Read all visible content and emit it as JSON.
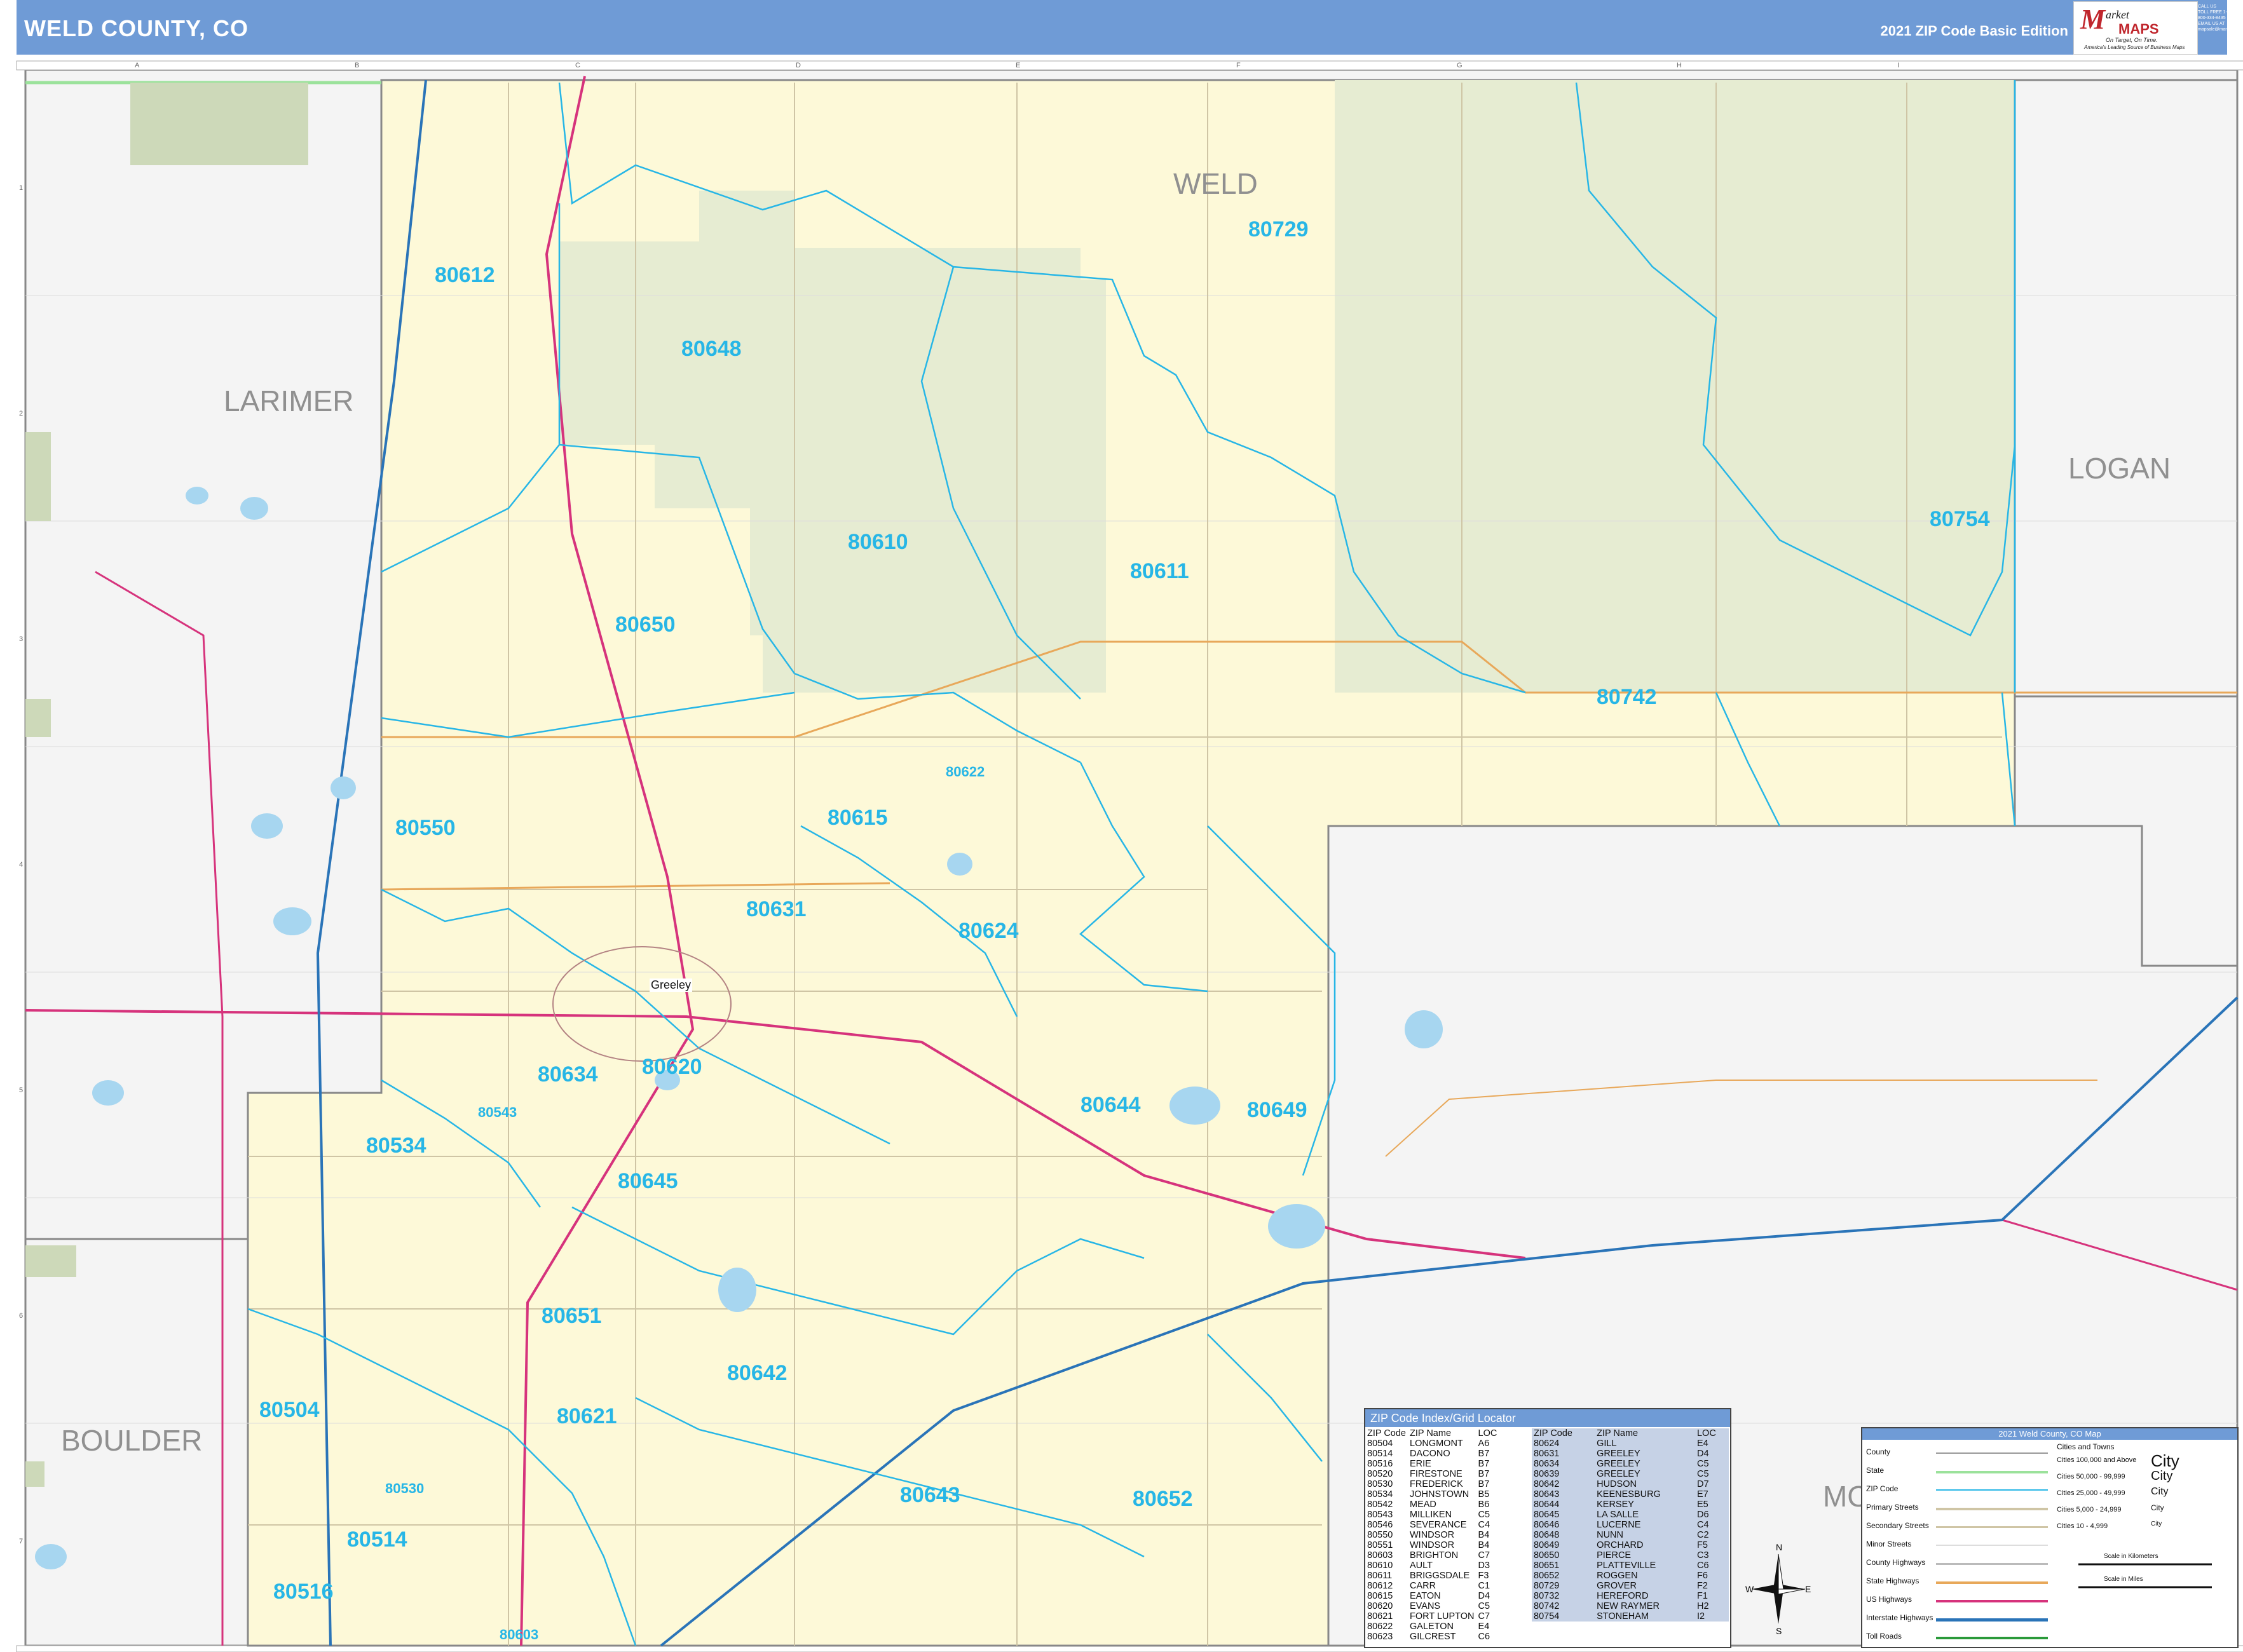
{
  "header": {
    "title": "WELD COUNTY, CO",
    "edition": "2021 ZIP Code Basic Edition",
    "logo_m": "M",
    "logo_name": "arket",
    "logo_name2": "MAPS",
    "logo_tag": "On Target, On Time.",
    "logo_tag2": "America's Leading Source of Business Maps",
    "contact": "CALL US TOLL FREE 1-800-334-8435 EMAIL US AT mapsale@marketmaps.com"
  },
  "grid": {
    "columns": [
      "A",
      "B",
      "C",
      "D",
      "E",
      "F",
      "G",
      "H",
      "I"
    ],
    "rows": [
      "1",
      "2",
      "3",
      "4",
      "5",
      "6",
      "7"
    ]
  },
  "counties": [
    {
      "name": "WELD"
    },
    {
      "name": "LARIMER"
    },
    {
      "name": "LOGAN"
    },
    {
      "name": "BOULDER"
    },
    {
      "name": "MO"
    }
  ],
  "zips": [
    {
      "code": "80729"
    },
    {
      "code": "80612"
    },
    {
      "code": "80648"
    },
    {
      "code": "80610"
    },
    {
      "code": "80611"
    },
    {
      "code": "80754"
    },
    {
      "code": "80650"
    },
    {
      "code": "80742"
    },
    {
      "code": "80622"
    },
    {
      "code": "80550"
    },
    {
      "code": "80615"
    },
    {
      "code": "80631"
    },
    {
      "code": "80624"
    },
    {
      "code": "80634"
    },
    {
      "code": "80620"
    },
    {
      "code": "80644"
    },
    {
      "code": "80649"
    },
    {
      "code": "80543"
    },
    {
      "code": "80534"
    },
    {
      "code": "80645"
    },
    {
      "code": "80651"
    },
    {
      "code": "80642"
    },
    {
      "code": "80504"
    },
    {
      "code": "80621"
    },
    {
      "code": "80643"
    },
    {
      "code": "80652"
    },
    {
      "code": "80530"
    },
    {
      "code": "80514"
    },
    {
      "code": "80516"
    },
    {
      "code": "80603"
    }
  ],
  "cities": [
    {
      "name": "Greeley"
    }
  ],
  "index": {
    "title": "ZIP Code Index/Grid Locator",
    "headers": [
      "ZIP Code",
      "ZIP Name",
      "LOC"
    ],
    "left": [
      [
        "80504",
        "LONGMONT",
        "A6"
      ],
      [
        "80514",
        "DACONO",
        "B7"
      ],
      [
        "80516",
        "ERIE",
        "B7"
      ],
      [
        "80520",
        "FIRESTONE",
        "B7"
      ],
      [
        "80530",
        "FREDERICK",
        "B7"
      ],
      [
        "80534",
        "JOHNSTOWN",
        "B5"
      ],
      [
        "80542",
        "MEAD",
        "B6"
      ],
      [
        "80543",
        "MILLIKEN",
        "C5"
      ],
      [
        "80546",
        "SEVERANCE",
        "C4"
      ],
      [
        "80550",
        "WINDSOR",
        "B4"
      ],
      [
        "80551",
        "WINDSOR",
        "B4"
      ],
      [
        "80603",
        "BRIGHTON",
        "C7"
      ],
      [
        "80610",
        "AULT",
        "D3"
      ],
      [
        "80611",
        "BRIGGSDALE",
        "F3"
      ],
      [
        "80612",
        "CARR",
        "C1"
      ],
      [
        "80615",
        "EATON",
        "D4"
      ],
      [
        "80620",
        "EVANS",
        "C5"
      ],
      [
        "80621",
        "FORT LUPTON",
        "C7"
      ],
      [
        "80622",
        "GALETON",
        "E4"
      ],
      [
        "80623",
        "GILCREST",
        "C6"
      ]
    ],
    "right": [
      [
        "80624",
        "GILL",
        "E4"
      ],
      [
        "80631",
        "GREELEY",
        "D4"
      ],
      [
        "80634",
        "GREELEY",
        "C5"
      ],
      [
        "80639",
        "GREELEY",
        "C5"
      ],
      [
        "80642",
        "HUDSON",
        "D7"
      ],
      [
        "80643",
        "KEENESBURG",
        "E7"
      ],
      [
        "80644",
        "KERSEY",
        "E5"
      ],
      [
        "80645",
        "LA SALLE",
        "D6"
      ],
      [
        "80646",
        "LUCERNE",
        "C4"
      ],
      [
        "80648",
        "NUNN",
        "C2"
      ],
      [
        "80649",
        "ORCHARD",
        "F5"
      ],
      [
        "80650",
        "PIERCE",
        "C3"
      ],
      [
        "80651",
        "PLATTEVILLE",
        "C6"
      ],
      [
        "80652",
        "ROGGEN",
        "F6"
      ],
      [
        "80729",
        "GROVER",
        "F2"
      ],
      [
        "80732",
        "HEREFORD",
        "F1"
      ],
      [
        "80742",
        "NEW RAYMER",
        "H2"
      ],
      [
        "80754",
        "STONEHAM",
        "I2"
      ]
    ]
  },
  "legend": {
    "title": "2021 Weld County, CO Map",
    "items": [
      "County",
      "State",
      "ZIP Code",
      "Primary Streets",
      "Secondary Streets",
      "Minor Streets",
      "County Highways",
      "State Highways",
      "US Highways",
      "Interstate Highways",
      "Toll Roads"
    ],
    "cities_title": "Cities and Towns",
    "city_sizes": [
      {
        "label": "Cities 100,000 and Above",
        "sample": "City"
      },
      {
        "label": "Cities 50,000 - 99,999",
        "sample": "City"
      },
      {
        "label": "Cities 25,000 - 49,999",
        "sample": "City"
      },
      {
        "label": "Cities 5,000 - 24,999",
        "sample": "City"
      },
      {
        "label": "Cities 10 - 4,999",
        "sample": "City"
      }
    ],
    "scale_km": "Scale in Kilometers",
    "scale_mi": "Scale in Miles"
  },
  "compass": {
    "n": "N",
    "s": "S",
    "e": "E",
    "w": "W"
  },
  "colors": {
    "header": "#6f9bd6",
    "county_fill": "#fdf9d8",
    "grassland": "#e6ecd2",
    "zip_boundary": "#27b6e6",
    "outside": "#f2f2f2",
    "us_highway": "#d6337c",
    "interstate": "#2a74b8",
    "state_highway": "#e8a85a"
  }
}
